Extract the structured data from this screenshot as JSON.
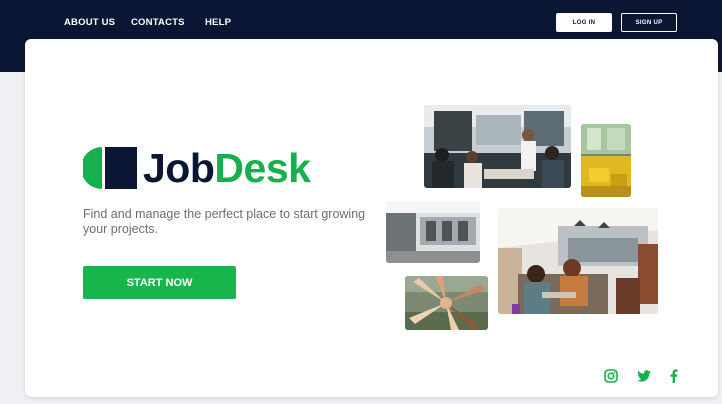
{
  "nav": {
    "links": [
      "ABOUT US",
      "CONTACTS",
      "HELP"
    ],
    "login_label": "LOG IN",
    "signup_label": "SIGN UP"
  },
  "brand": {
    "name_part1": "Job",
    "name_part2": "Desk",
    "navy": "#0b1634",
    "green": "#16b04e"
  },
  "hero": {
    "tagline": "Find and manage the perfect place to start growing your projects.",
    "cta_label": "START NOW"
  },
  "social": {
    "icons": [
      "instagram-icon",
      "twitter-icon",
      "facebook-icon"
    ]
  }
}
